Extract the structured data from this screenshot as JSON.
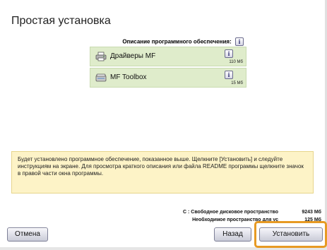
{
  "window": {
    "title": "Простая установка"
  },
  "software": {
    "header": "Описание программного обеспечения:",
    "info_glyph": "i",
    "items": [
      {
        "name": "Драйверы MF",
        "size": "110 Мб",
        "icon": "printer-icon"
      },
      {
        "name": "MF Toolbox",
        "size": "15 Мб",
        "icon": "scanner-icon"
      }
    ]
  },
  "note": {
    "text": "Будет установлено программное обеспечение, показанное выше. Щелкните [Установить] и следуйте инструкциям на экране. Для просмотра краткого описания или файла README программы щелкните значок в правой части окна программы."
  },
  "disk": {
    "free_label": "C : Свободное дисковое пространство",
    "free_value": "9243 Мб",
    "required_label": "Необходимое пространство для ус",
    "required_value": "125 Мб"
  },
  "buttons": {
    "cancel": "Отмена",
    "back": "Назад",
    "install": "Установить"
  },
  "colors": {
    "item_background": "#dfeccb",
    "note_background": "#fdf3c7",
    "highlight": "#e79a24"
  }
}
